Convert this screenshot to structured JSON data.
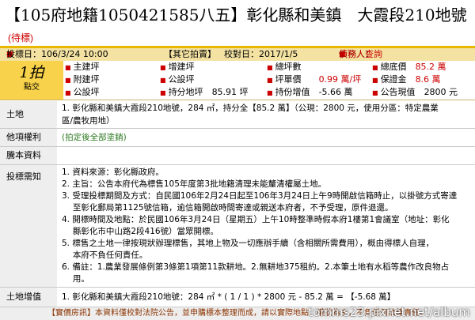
{
  "title": {
    "text": "【105府地籍1050421585八五】彰化縣和美鎮　大霞段210地號",
    "tag": "(待標)"
  },
  "info_bar": {
    "bid_date": "投標日：106/3/24 10:00",
    "source": "【其它拍賣】",
    "check_date": "校對日：2017/1/5",
    "agent_label": "債務人：",
    "agent_value": "債務人查詢"
  },
  "round": {
    "count": "1拍",
    "label": "點交"
  },
  "summary": {
    "main_area_label": "主建坪",
    "aux_area_label": "附建坪",
    "public_label": "公設坪",
    "add_area_label": "增建坪",
    "public_area_label": "公設坪",
    "land_label": "持分地坪",
    "land_value": "85.91 坪",
    "total_label": "總坪數",
    "unit_price_label": "坪單價",
    "unit_price_value": "0.99 萬/坪",
    "increment_label": "持份增值",
    "increment_value": "-5.66 萬",
    "base_price_label": "總底價",
    "base_price_value": "85.2 萬",
    "deposit_label": "保證金",
    "deposit_value": "8.6 萬",
    "announce_label": "公告現值",
    "announce_value": "2800 元"
  },
  "rows": [
    {
      "label": "土地",
      "lines": [
        "1. 彰化縣和美鎮大霞段210地號，284 ㎡，持分全【85.2 萬】（公現：2800 元，使用分區：特定農業",
        "區/農牧用地）"
      ]
    },
    {
      "label": "他項權利",
      "lines": [
        "(拍定後全部塗銷)"
      ]
    },
    {
      "label": "騰本資料",
      "lines": [
        ""
      ]
    },
    {
      "label": "投標需知",
      "lines": [
        "1. 資料來源：彰化縣政府。",
        "2. 主旨：公告本府代為標售105年度第3批地籍清理未能釐清權屬土地。",
        "3. 受理投標期間及方式：自民國106年2月24日起至106年3月24日上午9時開啟信箱時止，以掛號方式寄達",
        "　 至彰化郵局第1125號信箱，逾信箱開啟時間寄達或親送本府者，不予受理，原件退還。",
        "4. 開標時間及地點：於民國106年3月24日（星期五）上午10時整準時假本府1樓第1會議室（地址：彰化",
        "　 縣彰化市中山路2段416號）當眾開標。",
        "5. 標售之土地一律按現狀辦理標售，其地上物及一切應辦手續（含相關所需費用），概由得標人自理，",
        "　 本府不負任何責任。",
        "6. 備註：1.農業發展條例第3條第1項第11款耕地。2.無耕地375租約。2.本筆土地有水稻等農作改良物占",
        "　 用。"
      ]
    },
    {
      "label": "土地增值",
      "lines": [
        "1. 彰化縣和美鎮大霞段210地號：284 ㎡ * ( 1 / 1 ) * 2800 元 - 85.2 萬 = 【-5.68 萬】"
      ]
    }
  ],
  "footer": "【實價房訊】本資料僅校對法院公告，並申購標本整理而成，請以實際地點、權狀為主，不負任何法律責任。",
  "watermark": "tomms23.pixnet.net/album",
  "colors": {
    "accent": "#e8b800",
    "info_bg": "#f3e2a2",
    "red": "#cc0000",
    "green": "#2b7a1f"
  }
}
